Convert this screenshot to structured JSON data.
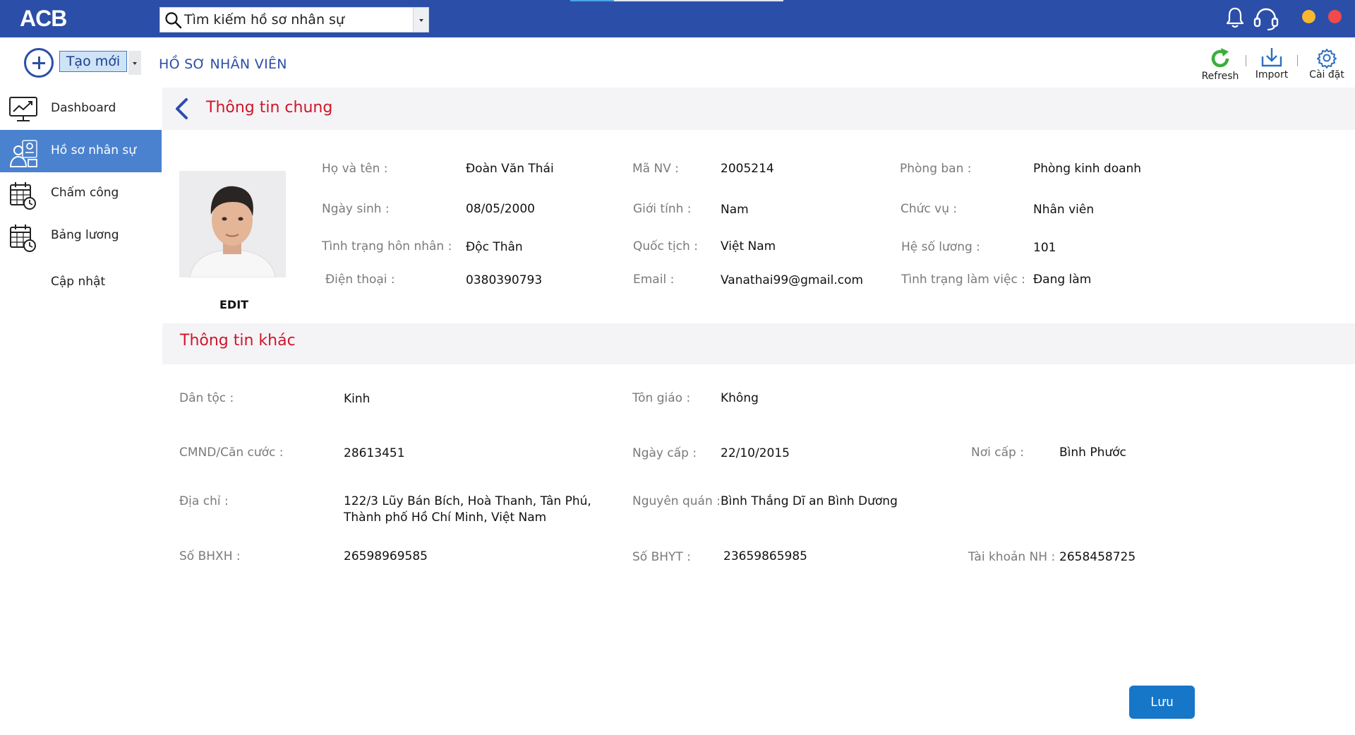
{
  "app": {
    "logo": "ACB"
  },
  "search": {
    "placeholder": "Tìm kiếm hồ sơ nhân sự"
  },
  "header": {
    "create_label": "Tạo mới",
    "page_title": "HỒ SƠ NHÂN VIÊN",
    "tools": {
      "refresh": "Refresh",
      "import": "Import",
      "settings": "Cài đặt"
    }
  },
  "colors": {
    "topbar": "#2b4ea8",
    "accent_red": "#d0162a",
    "active_sidebar": "#4a82cf",
    "save_button": "#1676c8",
    "dot_yellow": "#f5b82e",
    "dot_red": "#f04a4a"
  },
  "sidebar": {
    "items": [
      {
        "label": "Dashboard",
        "icon": "chart-icon"
      },
      {
        "label": "Hồ sơ nhân sự",
        "icon": "people-icon"
      },
      {
        "label": "Chấm công",
        "icon": "calendar-clock-icon"
      },
      {
        "label": "Bảng lương",
        "icon": "calendar-clock-icon"
      },
      {
        "label": "Cập nhật",
        "icon": ""
      }
    ]
  },
  "general": {
    "title": "Thông tin chung",
    "edit_label": "EDIT",
    "fields": {
      "full_name": {
        "label": "Họ và tên :",
        "value": "Đoàn Văn Thái"
      },
      "emp_id": {
        "label": "Mã NV :",
        "value": "2005214"
      },
      "department": {
        "label": "Phòng ban :",
        "value": "Phòng kinh doanh"
      },
      "dob": {
        "label": "Ngày sinh :",
        "value": "08/05/2000"
      },
      "gender": {
        "label": "Giới tính :",
        "value": "Nam"
      },
      "position": {
        "label": "Chức vụ :",
        "value": "Nhân viên"
      },
      "marital": {
        "label": "Tình trạng hôn nhân :",
        "value": "Độc Thân"
      },
      "nationality": {
        "label": "Quốc tịch :",
        "value": "Việt Nam"
      },
      "salary_coef": {
        "label": "Hệ số lương :",
        "value": "101"
      },
      "phone": {
        "label": "Điện thoại :",
        "value": "0380390793"
      },
      "email": {
        "label": "Email :",
        "value": "Vanathai99@gmail.com"
      },
      "work_status": {
        "label": "Tình trạng làm việc :",
        "value": "Đang làm"
      }
    }
  },
  "other": {
    "title": "Thông tin khác",
    "fields": {
      "ethnicity": {
        "label": "Dân tộc :",
        "value": "Kinh"
      },
      "religion": {
        "label": "Tôn giáo :",
        "value": "Không"
      },
      "id_card": {
        "label": "CMND/Căn cước :",
        "value": "28613451"
      },
      "issue_date": {
        "label": "Ngày cấp :",
        "value": "22/10/2015"
      },
      "issue_place": {
        "label": "Nơi cấp :",
        "value": "Bình Phước"
      },
      "address": {
        "label": "Địa chỉ :",
        "value": "122/3 Lũy Bán Bích, Hoà Thanh, Tân Phú, Thành phố Hồ Chí Minh, Việt Nam"
      },
      "hometown": {
        "label": "Nguyên quán :",
        "value": "Bình Thắng Dĩ an Bình Dương"
      },
      "social_ins": {
        "label": "Số BHXH :",
        "value": "26598969585"
      },
      "health_ins": {
        "label": "Số BHYT :",
        "value": "23659865985"
      },
      "bank_acc": {
        "label": "Tài khoản NH :",
        "value": "2658458725"
      }
    }
  },
  "footer": {
    "save_label": "Lưu"
  }
}
